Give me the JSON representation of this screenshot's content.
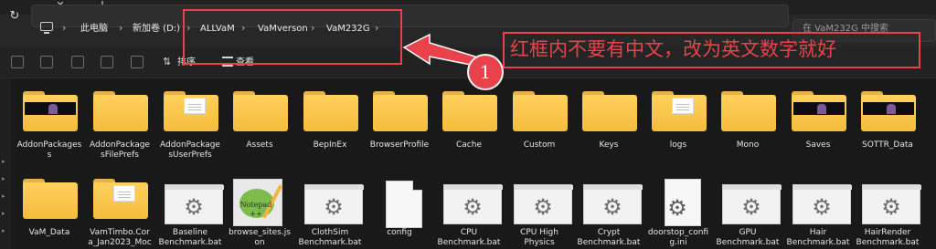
{
  "tab_bar": {
    "close_glyph": "✕",
    "new_tab_glyph": "+"
  },
  "address_bar": {
    "refresh_glyph": "↻",
    "breadcrumb": [
      "此电脑",
      "新加卷 (D:)",
      "ALLVaM",
      "VaMverson",
      "VaM232G"
    ],
    "separator": "›",
    "search_placeholder": "在 VaM232G 中搜索"
  },
  "toolbar": {
    "sort_label": "排序",
    "view_label": "查看"
  },
  "annotation": {
    "callout_text": "红框内不要有中文，改为英文数字就好",
    "number": "1",
    "color": "#e8434b"
  },
  "items": [
    {
      "label": "AddonPackages\ns",
      "icon": "folder-media-icon"
    },
    {
      "label": "AddonPackage\nsFilePrefs",
      "icon": "folder-icon"
    },
    {
      "label": "AddonPackage\nsUserPrefs",
      "icon": "folder-docs-icon"
    },
    {
      "label": "Assets",
      "icon": "folder-icon"
    },
    {
      "label": "BepInEx",
      "icon": "folder-icon"
    },
    {
      "label": "BrowserProfile",
      "icon": "folder-icon"
    },
    {
      "label": "Cache",
      "icon": "folder-icon"
    },
    {
      "label": "Custom",
      "icon": "folder-icon"
    },
    {
      "label": "Keys",
      "icon": "folder-icon"
    },
    {
      "label": "logs",
      "icon": "folder-docs-icon"
    },
    {
      "label": "Mono",
      "icon": "folder-icon"
    },
    {
      "label": "Saves",
      "icon": "folder-media-icon"
    },
    {
      "label": "SOTTR_Data",
      "icon": "folder-media-icon"
    },
    {
      "label": "VaM_Data",
      "icon": "folder-icon"
    },
    {
      "label": "VamTimbo.Cor\na_Jan2023_Moc",
      "icon": "folder-docs-icon"
    },
    {
      "label": "Baseline\nBenchmark.bat",
      "icon": "batch-file-icon"
    },
    {
      "label": "browse_sites.js\non",
      "icon": "notepad-plus-plus-icon"
    },
    {
      "label": "ClothSim\nBenchmark.bat",
      "icon": "batch-file-icon"
    },
    {
      "label": "config",
      "icon": "document-icon"
    },
    {
      "label": "CPU\nBenchmark.bat",
      "icon": "batch-file-icon"
    },
    {
      "label": "CPU High\nPhysics",
      "icon": "batch-file-icon"
    },
    {
      "label": "Crypt\nBenchmark.bat",
      "icon": "batch-file-icon"
    },
    {
      "label": "doorstop_confi\ng.ini",
      "icon": "settings-file-icon"
    },
    {
      "label": "GPU\nBenchmark.bat",
      "icon": "batch-file-icon"
    },
    {
      "label": "Hair\nBenchmark.bat",
      "icon": "batch-file-icon"
    },
    {
      "label": "HairRender\nBenchmark.bat",
      "icon": "batch-file-icon"
    }
  ],
  "npp_icon_text": "Notepad\n++"
}
